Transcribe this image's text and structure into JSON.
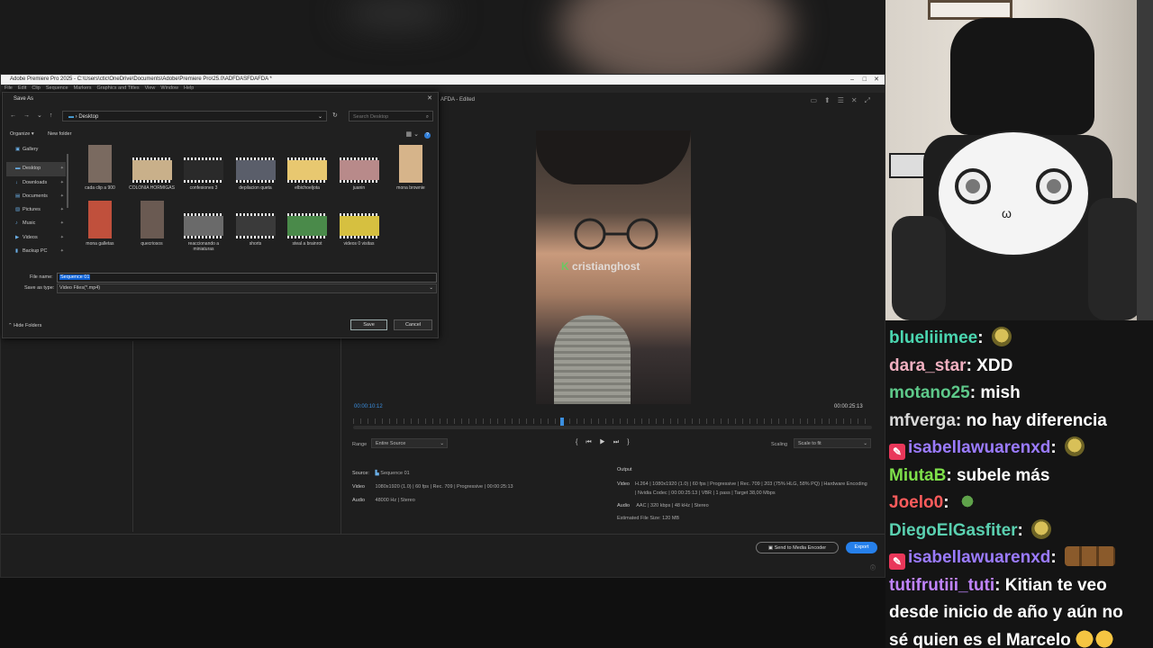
{
  "premiere": {
    "window_title": "Adobe Premiere Pro 2025 - C:\\Users\\ctic\\OneDrive\\Documents\\Adobe\\Premiere Pro\\25.0\\ADFDASFDAFDA *",
    "menu": [
      "File",
      "Edit",
      "Clip",
      "Sequence",
      "Markers",
      "Graphics and Titles",
      "View",
      "Window",
      "Help"
    ],
    "sequence_tab": "AFDA - Edited",
    "watermark": "cristianghost",
    "time_current": "00:00:10:12",
    "time_total": "00:00:25:13",
    "playhead_fraction": 0.4,
    "range_label": "Range",
    "range_value": "Entire Source",
    "scaling_label": "Scaling",
    "scaling_value": "Scale to fit",
    "source": {
      "label": "Source:",
      "name": "Sequence 01",
      "video_label": "Video",
      "video": "1080x1920 (1.0)  |  60 fps  |  Rec. 709  |  Progressive  |  00:00:25:13",
      "audio_label": "Audio",
      "audio": "48000 Hz  |  Stereo"
    },
    "output": {
      "label": "Output",
      "video_label": "Video",
      "video": "H.264  |  1080x1920 (1.0)  |  60 fps  |  Progressive  |  Rec. 709  |  203 (75% HLG, 58% PQ)  |  Hardware Encoding  |  Nvidia Codec  |  00:00:25:13  |  VBR  |  1 pass  |  Target 38,00 Mbps",
      "audio_label": "Audio",
      "audio": "AAC  |  320 kbps  |  48 kHz  |  Stereo",
      "size_label": "Estimated File Size:",
      "size": "120 MB"
    },
    "send_to_encoder": "Send to Media Encoder",
    "export": "Export"
  },
  "dialog": {
    "title": "Save As",
    "address": "Desktop",
    "search_placeholder": "Search Desktop",
    "organize": "Organize ▾",
    "new_folder": "New folder",
    "nav": [
      {
        "label": "Gallery",
        "icon": "▣"
      },
      {
        "label": "Desktop",
        "icon": "▬"
      },
      {
        "label": "Downloads",
        "icon": "↓"
      },
      {
        "label": "Documents",
        "icon": "▤"
      },
      {
        "label": "Pictures",
        "icon": "▨"
      },
      {
        "label": "Music",
        "icon": "♪"
      },
      {
        "label": "Videos",
        "icon": "▶"
      },
      {
        "label": "Backup PC",
        "icon": "▮"
      }
    ],
    "files": [
      {
        "name": "cada clip a 900",
        "shape": "v",
        "color": "#7a6a60"
      },
      {
        "name": "COLONIA HORMIGAS",
        "shape": "h",
        "color": "#c9b08a"
      },
      {
        "name": "confesiones 3",
        "shape": "h",
        "color": "#2a2a2a"
      },
      {
        "name": "depilacion queta",
        "shape": "h",
        "color": "#5a5e6a"
      },
      {
        "name": "elbichoeljota",
        "shape": "h",
        "color": "#e8c870"
      },
      {
        "name": "juanin",
        "shape": "h",
        "color": "#b88a8a"
      },
      {
        "name": "mona brownie",
        "shape": "v",
        "color": "#d6b48a"
      },
      {
        "name": "mona galletas",
        "shape": "v",
        "color": "#c0503c"
      },
      {
        "name": "quecriosos",
        "shape": "v",
        "color": "#6a5a52"
      },
      {
        "name": "reaccionando a miniaturas",
        "shape": "h",
        "color": "#6a6a6a"
      },
      {
        "name": "shorts",
        "shape": "h",
        "color": "#3a3a3a"
      },
      {
        "name": "steal a brainrot",
        "shape": "h",
        "color": "#4a8a4a"
      },
      {
        "name": "videos 0 visitas",
        "shape": "h",
        "color": "#d6c040"
      }
    ],
    "file_name_label": "File name:",
    "file_name": "Sequence 01",
    "save_type_label": "Save as type:",
    "save_type": "Video Files(*.mp4)",
    "hide_folders": "Hide Folders",
    "save": "Save",
    "cancel": "Cancel"
  },
  "chat": [
    {
      "user": "blueliiimee",
      "color": "#4bd6b0",
      "text": "",
      "emote": "cat",
      "badge": false
    },
    {
      "user": "dara_star",
      "color": "#f0b0c0",
      "text": "XDD",
      "emote": "",
      "badge": false
    },
    {
      "user": "motano25",
      "color": "#5ec98a",
      "text": "mish",
      "emote": "",
      "badge": false
    },
    {
      "user": "mfverga",
      "color": "#d8d8d8",
      "text": "no hay diferencia",
      "emote": "",
      "badge": false
    },
    {
      "user": "isabellawuarenxd",
      "color": "#9b7bff",
      "text": "",
      "emote": "cat",
      "badge": true
    },
    {
      "user": "MiutaB",
      "color": "#7ee04a",
      "text": "subele más",
      "emote": "",
      "badge": false
    },
    {
      "user": "Joelo0",
      "color": "#ff5c5c",
      "text": "",
      "emote": "frog",
      "badge": false
    },
    {
      "user": "DiegoElGasfiter",
      "color": "#5ad0b0",
      "text": "",
      "emote": "cat",
      "badge": false
    },
    {
      "user": "isabellawuarenxd",
      "color": "#9b7bff",
      "text": "",
      "emote": "monkeys",
      "badge": true
    },
    {
      "user": "tutifrutiii_tuti",
      "color": "#c084fc",
      "text": "Kitian te veo",
      "emote": "",
      "badge": false
    },
    {
      "user": "",
      "color": "#fff",
      "text": "desde inicio de año y aún no",
      "emote": "",
      "badge": false
    },
    {
      "user": "",
      "color": "#fff",
      "text": "sé quien es el Marcelo",
      "emote": "cry",
      "badge": false
    }
  ]
}
